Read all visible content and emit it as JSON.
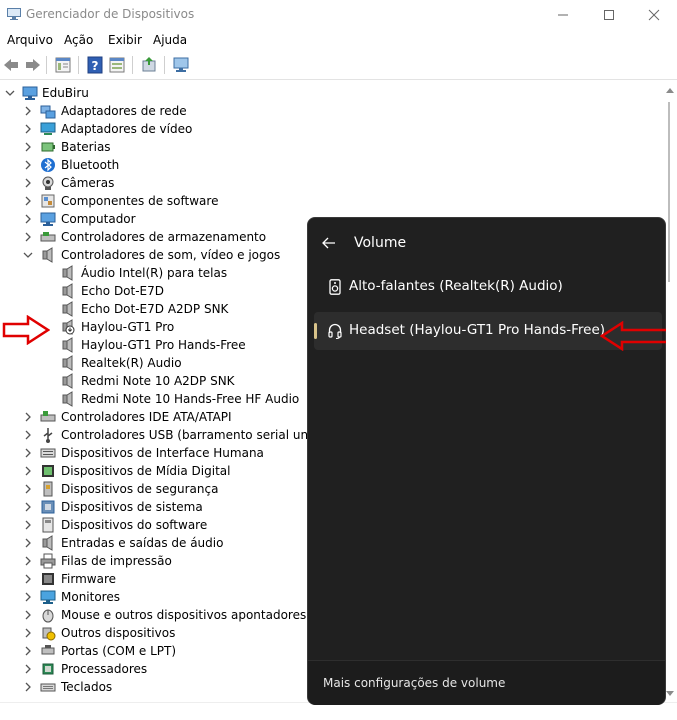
{
  "window": {
    "title": "Gerenciador de Dispositivos"
  },
  "menu": [
    "Arquivo",
    "Ação",
    "Exibir",
    "Ajuda"
  ],
  "toolbar_icons": [
    "back-icon",
    "forward-icon",
    "properties-icon",
    "help-icon",
    "view-icon",
    "update-driver-icon",
    "monitor-icon"
  ],
  "tree": {
    "root": "EduBiru",
    "items": [
      {
        "label": "Adaptadores de rede",
        "icon": "network-adapter-icon"
      },
      {
        "label": "Adaptadores de vídeo",
        "icon": "display-adapter-icon"
      },
      {
        "label": "Baterias",
        "icon": "battery-icon"
      },
      {
        "label": "Bluetooth",
        "icon": "bluetooth-icon"
      },
      {
        "label": "Câmeras",
        "icon": "camera-icon"
      },
      {
        "label": "Componentes de software",
        "icon": "software-component-icon"
      },
      {
        "label": "Computador",
        "icon": "computer-icon"
      },
      {
        "label": "Controladores de armazenamento",
        "icon": "storage-controller-icon"
      },
      {
        "label": "Controladores de som, vídeo e jogos",
        "icon": "speaker-icon",
        "expanded": true,
        "children": [
          {
            "label": "Áudio Intel(R) para telas",
            "icon": "speaker-icon"
          },
          {
            "label": "Echo Dot-E7D",
            "icon": "speaker-icon"
          },
          {
            "label": "Echo Dot-E7D A2DP SNK",
            "icon": "speaker-icon"
          },
          {
            "label": "Haylou-GT1 Pro",
            "icon": "speaker-disabled-icon"
          },
          {
            "label": "Haylou-GT1 Pro Hands-Free",
            "icon": "speaker-icon"
          },
          {
            "label": "Realtek(R) Audio",
            "icon": "speaker-icon"
          },
          {
            "label": "Redmi Note 10 A2DP SNK",
            "icon": "speaker-icon"
          },
          {
            "label": "Redmi Note 10 Hands-Free HF Audio",
            "icon": "speaker-icon"
          }
        ]
      },
      {
        "label": "Controladores IDE ATA/ATAPI",
        "icon": "ide-controller-icon"
      },
      {
        "label": "Controladores USB (barramento serial universal)",
        "icon": "usb-icon"
      },
      {
        "label": "Dispositivos de Interface Humana",
        "icon": "hid-icon"
      },
      {
        "label": "Dispositivos de Mídia Digital",
        "icon": "media-device-icon"
      },
      {
        "label": "Dispositivos de segurança",
        "icon": "security-device-icon"
      },
      {
        "label": "Dispositivos de sistema",
        "icon": "system-device-icon"
      },
      {
        "label": "Dispositivos do software",
        "icon": "software-device-icon"
      },
      {
        "label": "Entradas e saídas de áudio",
        "icon": "audio-io-icon"
      },
      {
        "label": "Filas de impressão",
        "icon": "printer-icon"
      },
      {
        "label": "Firmware",
        "icon": "firmware-icon"
      },
      {
        "label": "Monitores",
        "icon": "monitor-icon"
      },
      {
        "label": "Mouse e outros dispositivos apontadores",
        "icon": "mouse-icon"
      },
      {
        "label": "Outros dispositivos",
        "icon": "unknown-device-icon"
      },
      {
        "label": "Portas (COM e LPT)",
        "icon": "port-icon"
      },
      {
        "label": "Processadores",
        "icon": "processor-icon"
      },
      {
        "label": "Teclados",
        "icon": "keyboard-icon"
      }
    ]
  },
  "volume_flyout": {
    "title": "Volume",
    "outputs": [
      {
        "label": "Alto-falantes (Realtek(R) Audio)",
        "icon": "speaker-device-icon",
        "selected": false
      },
      {
        "label": "Headset (Haylou-GT1 Pro Hands-Free)",
        "icon": "headset-icon",
        "selected": true
      }
    ],
    "footer_link": "Mais configurações de volume"
  },
  "colors": {
    "flyout_bg": "#202020",
    "flyout_selected": "#2d2d2d",
    "accent": "#d8c38a",
    "annotation_arrow": "#e00000"
  }
}
